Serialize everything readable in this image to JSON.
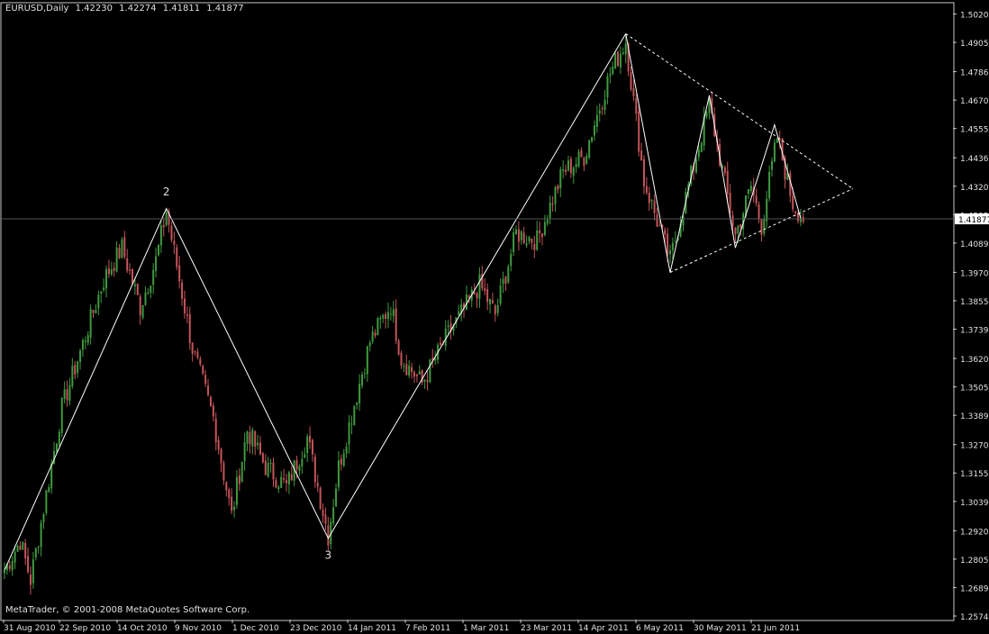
{
  "header": {
    "symbol": "EURUSD,Daily",
    "open": "1.42230",
    "high": "1.42274",
    "low": "1.41811",
    "close": "1.41877"
  },
  "copyright": "MetaTrader, © 2001-2008 MetaQuotes Software Corp.",
  "colors": {
    "background": "#000000",
    "frame": "#c8c8c8",
    "bull": "#3f9a3f",
    "bear": "#c4555a",
    "line": "#ffffff",
    "text": "#e0e0e0"
  },
  "chart_data": {
    "type": "candlestick",
    "ylim": [
      1.2574,
      1.5026
    ],
    "y_ticks": [
      "1.50205",
      "1.49050",
      "1.47860",
      "1.46705",
      "1.45550",
      "1.44360",
      "1.43205",
      "1.42050",
      "1.40895",
      "1.39705",
      "1.38550",
      "1.37395",
      "1.36205",
      "1.35050",
      "1.33895",
      "1.32705",
      "1.31550",
      "1.30395",
      "1.29205",
      "1.28050",
      "1.26895",
      "1.25740"
    ],
    "current_price": "1.41877",
    "x_ticks": [
      "31 Aug 2010",
      "22 Sep 2010",
      "14 Oct 2010",
      "9 Nov 2010",
      "1 Dec 2010",
      "23 Dec 2010",
      "14 Jan 2011",
      "7 Feb 2011",
      "1 Mar 2011",
      "23 Mar 2011",
      "14 Apr 2011",
      "6 May 2011",
      "30 May 2011",
      "21 Jun 2011"
    ],
    "wave_labels": [
      {
        "text": "2",
        "bar": 62,
        "price": 1.424,
        "position": "above"
      },
      {
        "text": "3",
        "bar": 124,
        "price": 1.288,
        "position": "below"
      }
    ],
    "zigzag": [
      {
        "bar": 0,
        "price": 1.276
      },
      {
        "bar": 62,
        "price": 1.423
      },
      {
        "bar": 124,
        "price": 1.289
      },
      {
        "bar": 238,
        "price": 1.494
      }
    ],
    "triangle": [
      {
        "bar": 238,
        "price": 1.494
      },
      {
        "bar": 255,
        "price": 1.397
      },
      {
        "bar": 270,
        "price": 1.469
      },
      {
        "bar": 280,
        "price": 1.407
      },
      {
        "bar": 295,
        "price": 1.457
      },
      {
        "bar": 305,
        "price": 1.419
      }
    ],
    "triangle_upper": [
      {
        "bar": 238,
        "price": 1.494
      },
      {
        "bar": 325,
        "price": 1.431
      }
    ],
    "triangle_lower": [
      {
        "bar": 255,
        "price": 1.397
      },
      {
        "bar": 325,
        "price": 1.431
      }
    ],
    "series_anchors": [
      {
        "bar": 0,
        "price": 1.276
      },
      {
        "bar": 6,
        "price": 1.288
      },
      {
        "bar": 10,
        "price": 1.272
      },
      {
        "bar": 22,
        "price": 1.342
      },
      {
        "bar": 38,
        "price": 1.394
      },
      {
        "bar": 45,
        "price": 1.407
      },
      {
        "bar": 52,
        "price": 1.383
      },
      {
        "bar": 58,
        "price": 1.402
      },
      {
        "bar": 62,
        "price": 1.422
      },
      {
        "bar": 72,
        "price": 1.366
      },
      {
        "bar": 80,
        "price": 1.338
      },
      {
        "bar": 87,
        "price": 1.298
      },
      {
        "bar": 93,
        "price": 1.333
      },
      {
        "bar": 100,
        "price": 1.318
      },
      {
        "bar": 108,
        "price": 1.31
      },
      {
        "bar": 116,
        "price": 1.33
      },
      {
        "bar": 124,
        "price": 1.29
      },
      {
        "bar": 128,
        "price": 1.318
      },
      {
        "bar": 140,
        "price": 1.369
      },
      {
        "bar": 148,
        "price": 1.384
      },
      {
        "bar": 152,
        "price": 1.362
      },
      {
        "bar": 160,
        "price": 1.352
      },
      {
        "bar": 170,
        "price": 1.372
      },
      {
        "bar": 182,
        "price": 1.392
      },
      {
        "bar": 188,
        "price": 1.38
      },
      {
        "bar": 196,
        "price": 1.413
      },
      {
        "bar": 204,
        "price": 1.41
      },
      {
        "bar": 214,
        "price": 1.438
      },
      {
        "bar": 222,
        "price": 1.444
      },
      {
        "bar": 232,
        "price": 1.478
      },
      {
        "bar": 238,
        "price": 1.491
      },
      {
        "bar": 245,
        "price": 1.434
      },
      {
        "bar": 255,
        "price": 1.402
      },
      {
        "bar": 262,
        "price": 1.432
      },
      {
        "bar": 270,
        "price": 1.465
      },
      {
        "bar": 280,
        "price": 1.412
      },
      {
        "bar": 286,
        "price": 1.432
      },
      {
        "bar": 290,
        "price": 1.416
      },
      {
        "bar": 296,
        "price": 1.452
      },
      {
        "bar": 302,
        "price": 1.425
      },
      {
        "bar": 306,
        "price": 1.419
      }
    ],
    "bar_count": 307,
    "grid": false
  }
}
